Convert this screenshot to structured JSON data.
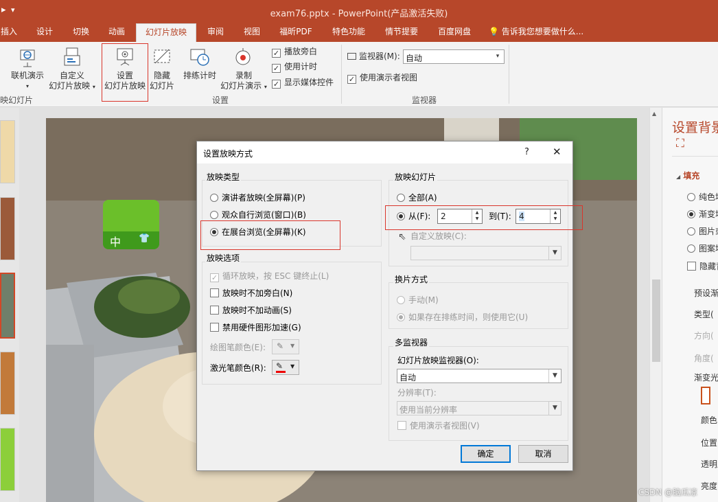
{
  "window": {
    "title": "exam76.pptx - PowerPoint(产品激活失败)"
  },
  "tabs": [
    {
      "label": "插入"
    },
    {
      "label": "设计"
    },
    {
      "label": "切换"
    },
    {
      "label": "动画"
    },
    {
      "label": "幻灯片放映"
    },
    {
      "label": "审阅"
    },
    {
      "label": "视图"
    },
    {
      "label": "福昕PDF"
    },
    {
      "label": "特色功能"
    },
    {
      "label": "情节提要"
    },
    {
      "label": "百度网盘"
    }
  ],
  "tell_me": "告诉我您想要做什么...",
  "ribbon": {
    "broadcast": "联机演示",
    "custom_show_1": "自定义",
    "custom_show_2": "幻灯片放映",
    "setup_1": "设置",
    "setup_2": "幻灯片放映",
    "hide_1": "隐藏",
    "hide_2": "幻灯片",
    "rehearse": "排练计时",
    "record_1": "录制",
    "record_2": "幻灯片演示",
    "play_narrations": "播放旁白",
    "use_timings": "使用计时",
    "show_media_controls": "显示媒体控件",
    "monitor_label": "监视器(M):",
    "monitor_value": "自动",
    "presenter_view": "使用演示者视图",
    "group_start": "映幻灯片",
    "group_setup": "设置",
    "group_monitors": "监视器"
  },
  "right_pane": {
    "title": "设置背景",
    "section": "填充",
    "options": [
      "纯色填",
      "渐变填",
      "图片或",
      "图案填"
    ],
    "hide_bg": "隐藏背",
    "preset": "预设渐",
    "type": "类型(",
    "direction": "方向(",
    "angle": "角度(",
    "gradient_stops": "渐变光",
    "color": "颜色(",
    "position": "位置(",
    "transparency": "透明度",
    "brightness": "亮度("
  },
  "slide": {
    "logo_char": "中"
  },
  "dialog": {
    "title": "设置放映方式",
    "help": "?",
    "close": "✕",
    "show_type": {
      "legend": "放映类型",
      "presenter": "演讲者放映(全屏幕)(P)",
      "browsed_window": "观众自行浏览(窗口)(B)",
      "kiosk": "在展台浏览(全屏幕)(K)"
    },
    "show_options": {
      "legend": "放映选项",
      "loop": "循环放映，按 ESC 键终止(L)",
      "no_narration": "放映时不加旁白(N)",
      "no_animation": "放映时不加动画(S)",
      "disable_hw": "禁用硬件图形加速(G)",
      "pen_color": "绘图笔颜色(E):",
      "laser_color": "激光笔颜色(R):"
    },
    "show_slides": {
      "legend": "放映幻灯片",
      "all": "全部(A)",
      "from": "从(F):",
      "from_value": "2",
      "to": "到(T):",
      "to_value": "4",
      "custom": "自定义放映(C):"
    },
    "advance": {
      "legend": "换片方式",
      "manual": "手动(M)",
      "timings": "如果存在排练时间，则使用它(U)"
    },
    "multi_monitor": {
      "legend": "多监视器",
      "monitor_label": "幻灯片放映监视器(O):",
      "monitor_value": "自动",
      "resolution_label": "分辨率(T):",
      "resolution_value": "使用当前分辨率",
      "presenter_view": "使用演示者视图(V)"
    },
    "ok": "确定",
    "cancel": "取消"
  },
  "watermark": "CSDN @脑瓜凉"
}
